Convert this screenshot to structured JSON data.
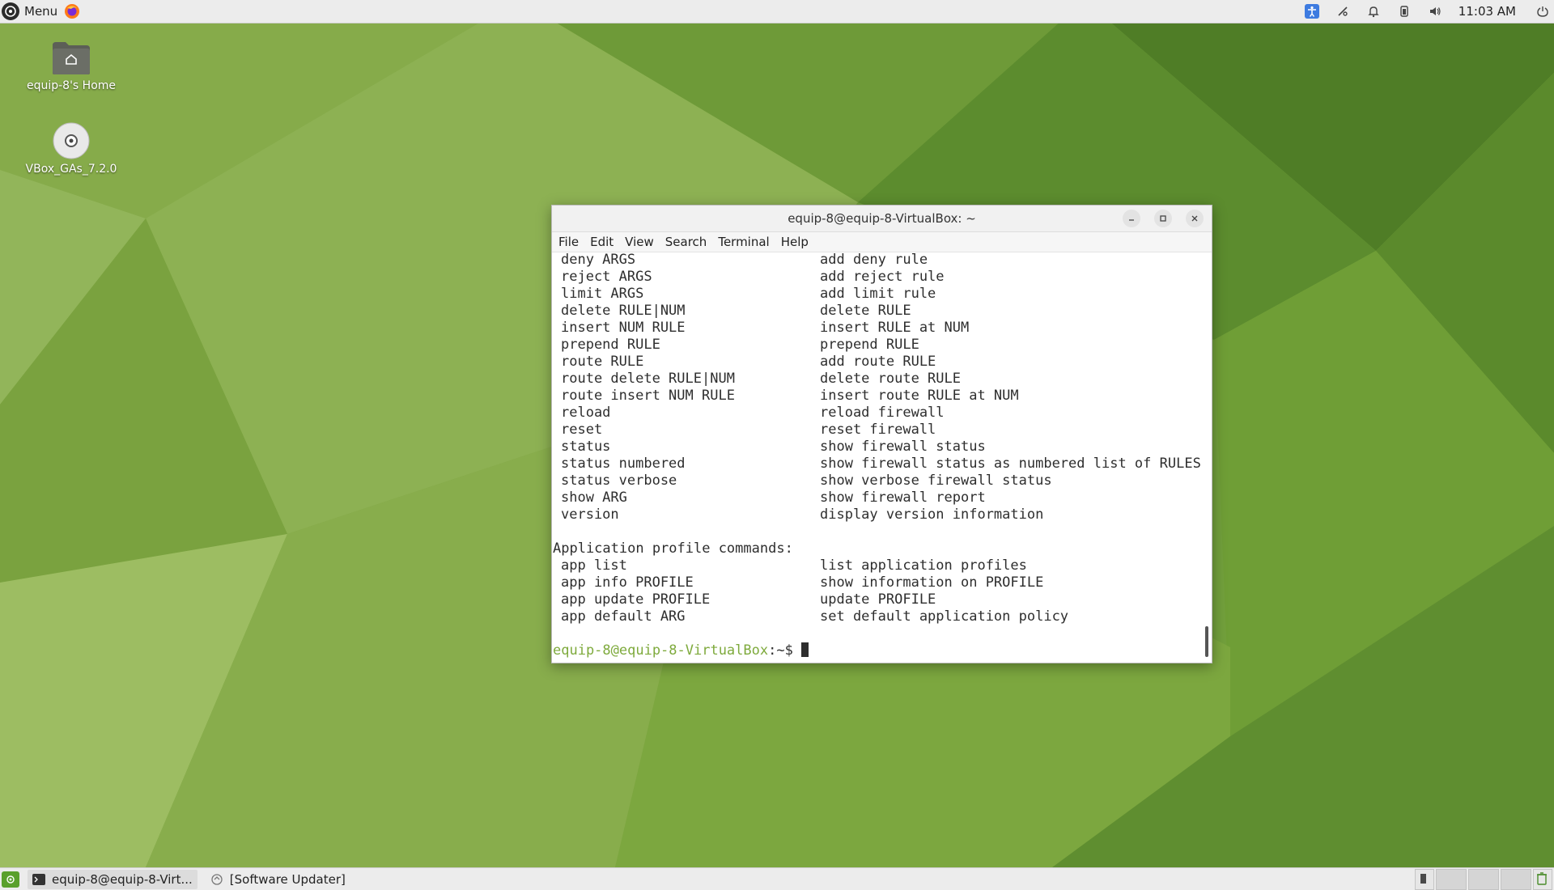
{
  "top_panel": {
    "menu_label": "Menu",
    "clock": "11:03 AM",
    "tray_icons": [
      "accessibility-icon",
      "network-icon",
      "bell-icon",
      "battery-icon",
      "volume-icon",
      "power-icon"
    ]
  },
  "desktop_icons": [
    {
      "label": "equip-8's Home",
      "icon": "home-folder-icon"
    },
    {
      "label": "VBox_GAs_7.2.0",
      "icon": "disc-icon"
    }
  ],
  "terminal": {
    "title": "equip-8@equip-8-VirtualBox: ~",
    "menu": [
      "File",
      "Edit",
      "View",
      "Search",
      "Terminal",
      "Help"
    ],
    "rules": [
      {
        "cmd": "deny ARGS",
        "desc": "add deny rule"
      },
      {
        "cmd": "reject ARGS",
        "desc": "add reject rule"
      },
      {
        "cmd": "limit ARGS",
        "desc": "add limit rule"
      },
      {
        "cmd": "delete RULE|NUM",
        "desc": "delete RULE"
      },
      {
        "cmd": "insert NUM RULE",
        "desc": "insert RULE at NUM"
      },
      {
        "cmd": "prepend RULE",
        "desc": "prepend RULE"
      },
      {
        "cmd": "route RULE",
        "desc": "add route RULE"
      },
      {
        "cmd": "route delete RULE|NUM",
        "desc": "delete route RULE"
      },
      {
        "cmd": "route insert NUM RULE",
        "desc": "insert route RULE at NUM"
      },
      {
        "cmd": "reload",
        "desc": "reload firewall"
      },
      {
        "cmd": "reset",
        "desc": "reset firewall"
      },
      {
        "cmd": "status",
        "desc": "show firewall status"
      },
      {
        "cmd": "status numbered",
        "desc": "show firewall status as numbered list of RULES"
      },
      {
        "cmd": "status verbose",
        "desc": "show verbose firewall status"
      },
      {
        "cmd": "show ARG",
        "desc": "show firewall report"
      },
      {
        "cmd": "version",
        "desc": "display version information"
      }
    ],
    "app_section_header": "Application profile commands:",
    "app_rules": [
      {
        "cmd": "app list",
        "desc": "list application profiles"
      },
      {
        "cmd": "app info PROFILE",
        "desc": "show information on PROFILE"
      },
      {
        "cmd": "app update PROFILE",
        "desc": "update PROFILE"
      },
      {
        "cmd": "app default ARG",
        "desc": "set default application policy"
      }
    ],
    "prompt_user_host": "equip-8@equip-8-VirtualBox",
    "prompt_suffix": ":~$"
  },
  "bottom_panel": {
    "tasks": [
      {
        "label": "equip-8@equip-8-Virt...",
        "active": true
      },
      {
        "label": "[Software Updater]",
        "active": false
      }
    ]
  },
  "colors": {
    "wallpaper_base": "#7a9e3e",
    "prompt_green": "#7eaa3c",
    "panel_bg": "#ececec"
  }
}
